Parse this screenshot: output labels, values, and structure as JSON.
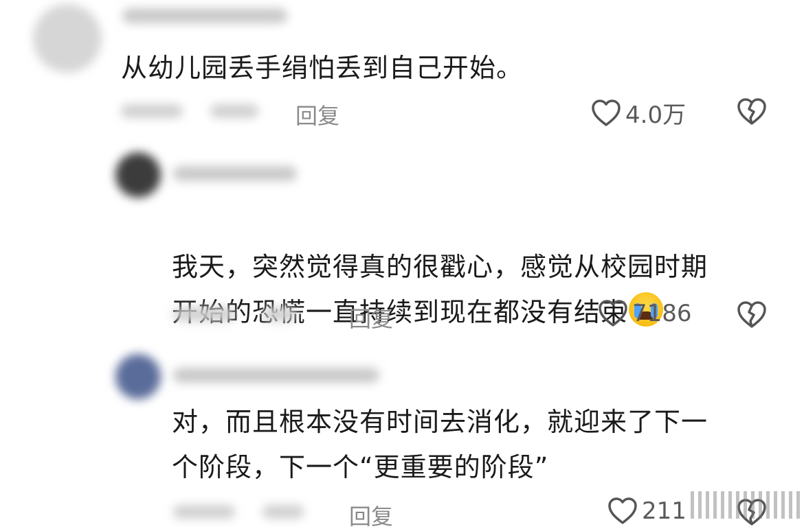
{
  "comments": [
    {
      "text": "从幼儿园丢手绢怕丢到自己开始。",
      "reply_label": "回复",
      "likes": "4.0万"
    },
    {
      "text": "我天，突然觉得真的很戳心，感觉从校园时期\n开始的恐慌一直持续到现在都没有结束",
      "reply_label": "回复",
      "likes": "7186"
    },
    {
      "text": "对，而且根本没有时间去消化，就迎来了下一\n个阶段，下一个“更重要的阶段”",
      "reply_label": "回复",
      "likes": "211"
    }
  ],
  "icons": {
    "like": "heart-outline-icon",
    "dislike": "broken-heart-icon",
    "emoji": "loudly-crying-face-emoji"
  }
}
